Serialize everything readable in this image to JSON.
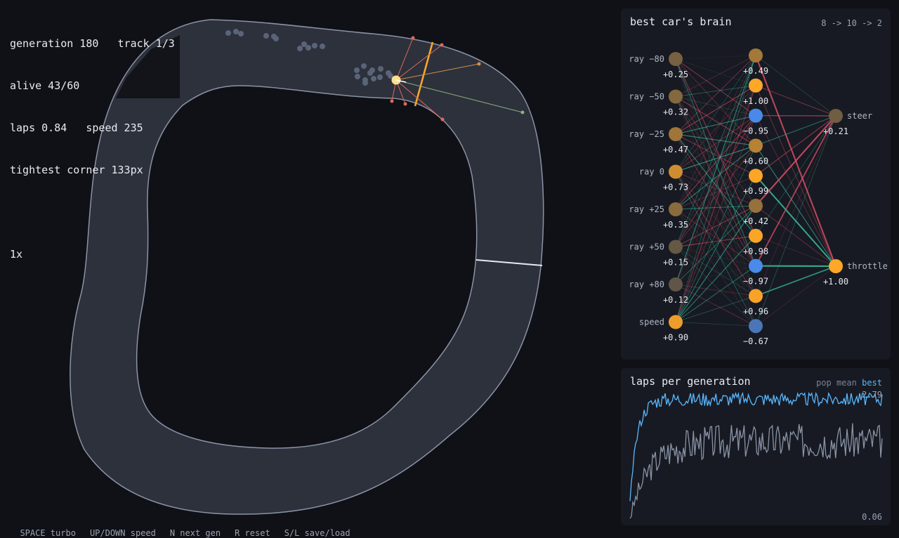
{
  "hud": {
    "line1": "generation 180   track 1/3",
    "line2": "alive 43/60",
    "line3": "laps 0.84   speed 235",
    "line4": "tightest corner 133px",
    "speed_multiplier": "1x"
  },
  "help": [
    "SPACE turbo",
    "UP/DOWN speed",
    "N next gen",
    "R reset",
    "S/L save/load"
  ],
  "brain": {
    "title": "best car's brain",
    "architecture": "8 -> 10 -> 2",
    "inputs": [
      {
        "label": "ray −80",
        "value": "+0.25"
      },
      {
        "label": "ray −50",
        "value": "+0.32"
      },
      {
        "label": "ray −25",
        "value": "+0.47"
      },
      {
        "label": "ray 0",
        "value": "+0.73"
      },
      {
        "label": "ray +25",
        "value": "+0.35"
      },
      {
        "label": "ray +50",
        "value": "+0.15"
      },
      {
        "label": "ray +80",
        "value": "+0.12"
      },
      {
        "label": "speed",
        "value": "+0.90"
      }
    ],
    "hidden": [
      "+0.49",
      "+1.00",
      "−0.95",
      "+0.60",
      "+0.99",
      "+0.42",
      "+0.98",
      "−0.97",
      "+0.96",
      "−0.67"
    ],
    "outputs": [
      {
        "label": "steer",
        "value": "+0.21"
      },
      {
        "label": "throttle",
        "value": "+1.00"
      }
    ],
    "colors": {
      "positive": "#ffa726",
      "negative": "#4a8cf0",
      "neutral": "#4a4a4a",
      "pos_weight": "#3cc9a8",
      "neg_weight": "#e0506a"
    }
  },
  "chart": {
    "title": "laps per generation",
    "legend_pop": "pop mean",
    "legend_best": "best",
    "max_label": "2.79",
    "min_label": "0.06"
  },
  "chart_data": {
    "type": "line",
    "title": "laps per generation",
    "x_range": [
      1,
      180
    ],
    "ylim": [
      0.06,
      2.79
    ],
    "series": [
      {
        "name": "pop mean",
        "color": "#8a93a6",
        "n": 180,
        "start": 0.06,
        "plateau": 1.75
      },
      {
        "name": "best",
        "color": "#5ab8ff",
        "n": 180,
        "start": 0.4,
        "plateau": 2.67
      }
    ]
  }
}
